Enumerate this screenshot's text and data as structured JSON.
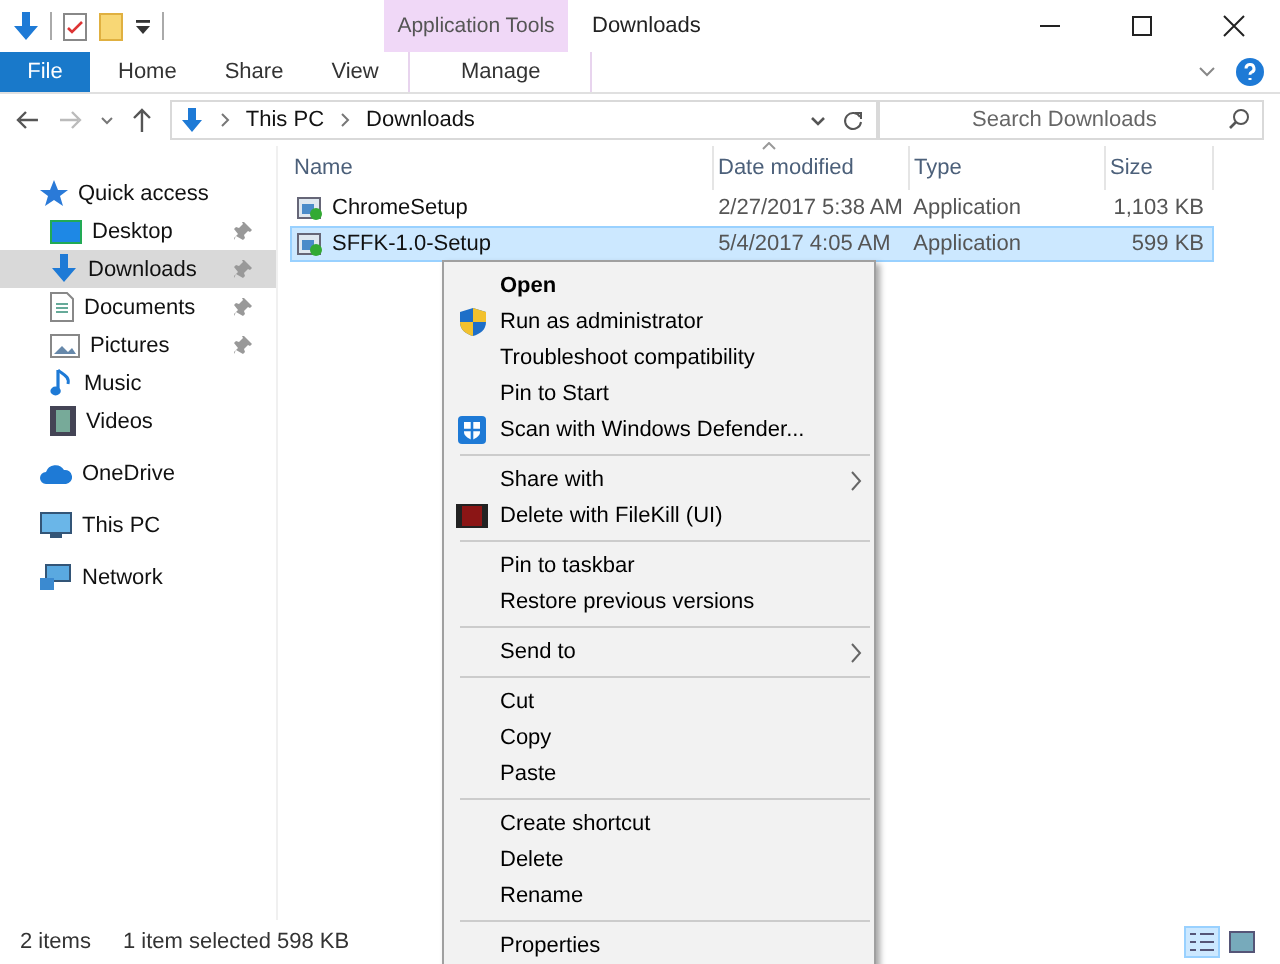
{
  "window": {
    "title": "Downloads",
    "context_header": "Application Tools"
  },
  "ribbon_tabs": [
    {
      "label": "File",
      "kind": "file"
    },
    {
      "label": "Home",
      "kind": "tab"
    },
    {
      "label": "Share",
      "kind": "tab"
    },
    {
      "label": "View",
      "kind": "tab"
    },
    {
      "label": "Manage",
      "kind": "contextual"
    }
  ],
  "address": {
    "path": [
      "This PC",
      "Downloads"
    ]
  },
  "search": {
    "placeholder": "Search Downloads"
  },
  "sidebar": {
    "items": [
      {
        "label": "Quick access",
        "selected": false,
        "children": [
          {
            "label": "Desktop",
            "selected": false,
            "pinned": true
          },
          {
            "label": "Downloads",
            "selected": true,
            "pinned": true
          },
          {
            "label": "Documents",
            "selected": false,
            "pinned": true
          },
          {
            "label": "Pictures",
            "selected": false,
            "pinned": true
          },
          {
            "label": "Music",
            "selected": false,
            "pinned": false
          },
          {
            "label": "Videos",
            "selected": false,
            "pinned": false
          }
        ]
      },
      {
        "label": "OneDrive",
        "selected": false
      },
      {
        "label": "This PC",
        "selected": false
      },
      {
        "label": "Network",
        "selected": false
      }
    ]
  },
  "table": {
    "columns": [
      "Name",
      "Date modified",
      "Type",
      "Size"
    ],
    "rows": [
      {
        "name": "ChromeSetup",
        "date": "2/27/2017 5:38 AM",
        "type": "Application",
        "size": "1,103 KB",
        "selected": false
      },
      {
        "name": "SFFK-1.0-Setup",
        "date": "5/4/2017 4:05 AM",
        "type": "Application",
        "size": "599 KB",
        "selected": true
      }
    ]
  },
  "context_menu": {
    "groups": [
      [
        {
          "label": "Open",
          "default": true,
          "submenu": false
        },
        {
          "label": "Run as administrator",
          "default": false,
          "submenu": false
        },
        {
          "label": "Troubleshoot compatibility",
          "default": false,
          "submenu": false
        },
        {
          "label": "Pin to Start",
          "default": false,
          "submenu": false
        },
        {
          "label": "Scan with Windows Defender...",
          "default": false,
          "submenu": false
        }
      ],
      [
        {
          "label": "Share with",
          "default": false,
          "submenu": true
        },
        {
          "label": "Delete with FileKill (UI)",
          "default": false,
          "submenu": false
        }
      ],
      [
        {
          "label": "Pin to taskbar",
          "default": false,
          "submenu": false
        },
        {
          "label": "Restore previous versions",
          "default": false,
          "submenu": false
        }
      ],
      [
        {
          "label": "Send to",
          "default": false,
          "submenu": true
        }
      ],
      [
        {
          "label": "Cut",
          "default": false,
          "submenu": false
        },
        {
          "label": "Copy",
          "default": false,
          "submenu": false
        },
        {
          "label": "Paste",
          "default": false,
          "submenu": false
        }
      ],
      [
        {
          "label": "Create shortcut",
          "default": false,
          "submenu": false
        },
        {
          "label": "Delete",
          "default": false,
          "submenu": false
        },
        {
          "label": "Rename",
          "default": false,
          "submenu": false
        }
      ],
      [
        {
          "label": "Properties",
          "default": false,
          "submenu": false
        }
      ]
    ]
  },
  "status_bar": {
    "count": "2 items",
    "selection": "1 item selected  598 KB",
    "views": [
      {
        "selected": true
      },
      {
        "selected": false
      }
    ]
  }
}
